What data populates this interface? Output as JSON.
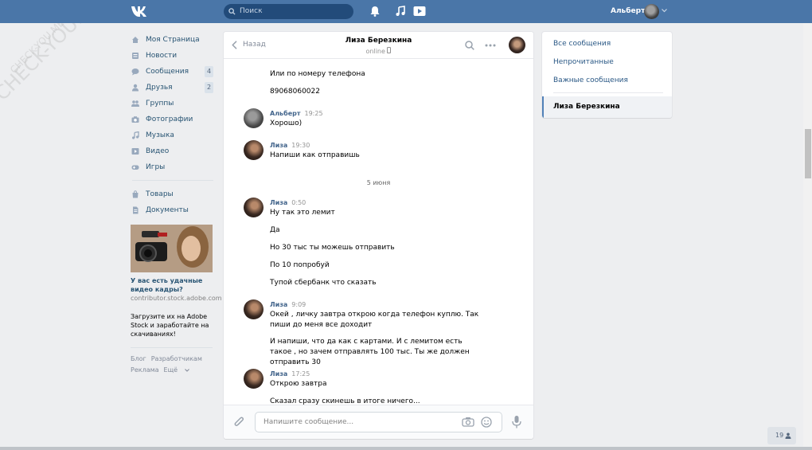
{
  "header": {
    "search_placeholder": "Поиск",
    "user_name": "Альберт",
    "icons": [
      "vk-logo-icon",
      "bell-icon",
      "music-icon",
      "video-play-icon"
    ]
  },
  "nav": {
    "items": [
      {
        "label": "Моя Страница",
        "icon": "home-icon",
        "badge": ""
      },
      {
        "label": "Новости",
        "icon": "news-icon",
        "badge": ""
      },
      {
        "label": "Сообщения",
        "icon": "messages-icon",
        "badge": "4"
      },
      {
        "label": "Друзья",
        "icon": "friends-icon",
        "badge": "2"
      },
      {
        "label": "Группы",
        "icon": "groups-icon",
        "badge": ""
      },
      {
        "label": "Фотографии",
        "icon": "camera-icon",
        "badge": ""
      },
      {
        "label": "Музыка",
        "icon": "music-icon",
        "badge": ""
      },
      {
        "label": "Видео",
        "icon": "video-icon",
        "badge": ""
      },
      {
        "label": "Игры",
        "icon": "games-icon",
        "badge": ""
      }
    ],
    "items2": [
      {
        "label": "Товары",
        "icon": "goods-icon"
      },
      {
        "label": "Документы",
        "icon": "documents-icon"
      }
    ],
    "ad": {
      "title": "У вас есть удачные видео кадры?",
      "domain": "contributor.stock.adobe.com",
      "text": "Загрузите их на Adobe Stock и заработайте на скачиваниях!"
    },
    "footer": {
      "blog": "Блог",
      "devs": "Разработчикам",
      "ads": "Реклама",
      "more": "Ещё"
    }
  },
  "chat": {
    "back_label": "Назад",
    "peer_name": "Лиза Березкина",
    "peer_status": "online",
    "composer_placeholder": "Напишите сообщение...",
    "day_separator": "5 июня",
    "m0_text1": "Или по номеру телефона",
    "m0_text2": "89068060022",
    "m1_author": "Альберт",
    "m1_time": "19:25",
    "m1_text": "Хорошо)",
    "m2_author": "Лиза",
    "m2_time": "19:30",
    "m2_text": "Напиши как отправишь",
    "m3_author": "Лиза",
    "m3_time": "0:50",
    "m3_lines": [
      "Ну так это лемит",
      "Да",
      "Но 30 тыс ты можешь отправить",
      "По 10 попробуй",
      "Тупой сбербанк что сказать"
    ],
    "m4_author": "Лиза",
    "m4_time": "9:09",
    "m4_text1": "Окей , личку завтра открою когда телефон куплю. Так пиши до меня все доходит",
    "m4_text2": "И напиши, что да как с картами. И с лемитом есть такое , но зачем отправлять 100 тыс. Ты же должен отправить 30",
    "m5_author": "Лиза",
    "m5_time": "17:25",
    "m5_text1": "Открою завтра",
    "m5_text2": "Сказал сразу скинешь в итоге ничего..."
  },
  "right_menu": {
    "all": "Все сообщения",
    "unread": "Непрочитанные",
    "important": "Важные сообщения",
    "active_chat": "Лиза Березкина"
  },
  "corner_counter": "19",
  "watermark": "CHECK-YOU.ME"
}
